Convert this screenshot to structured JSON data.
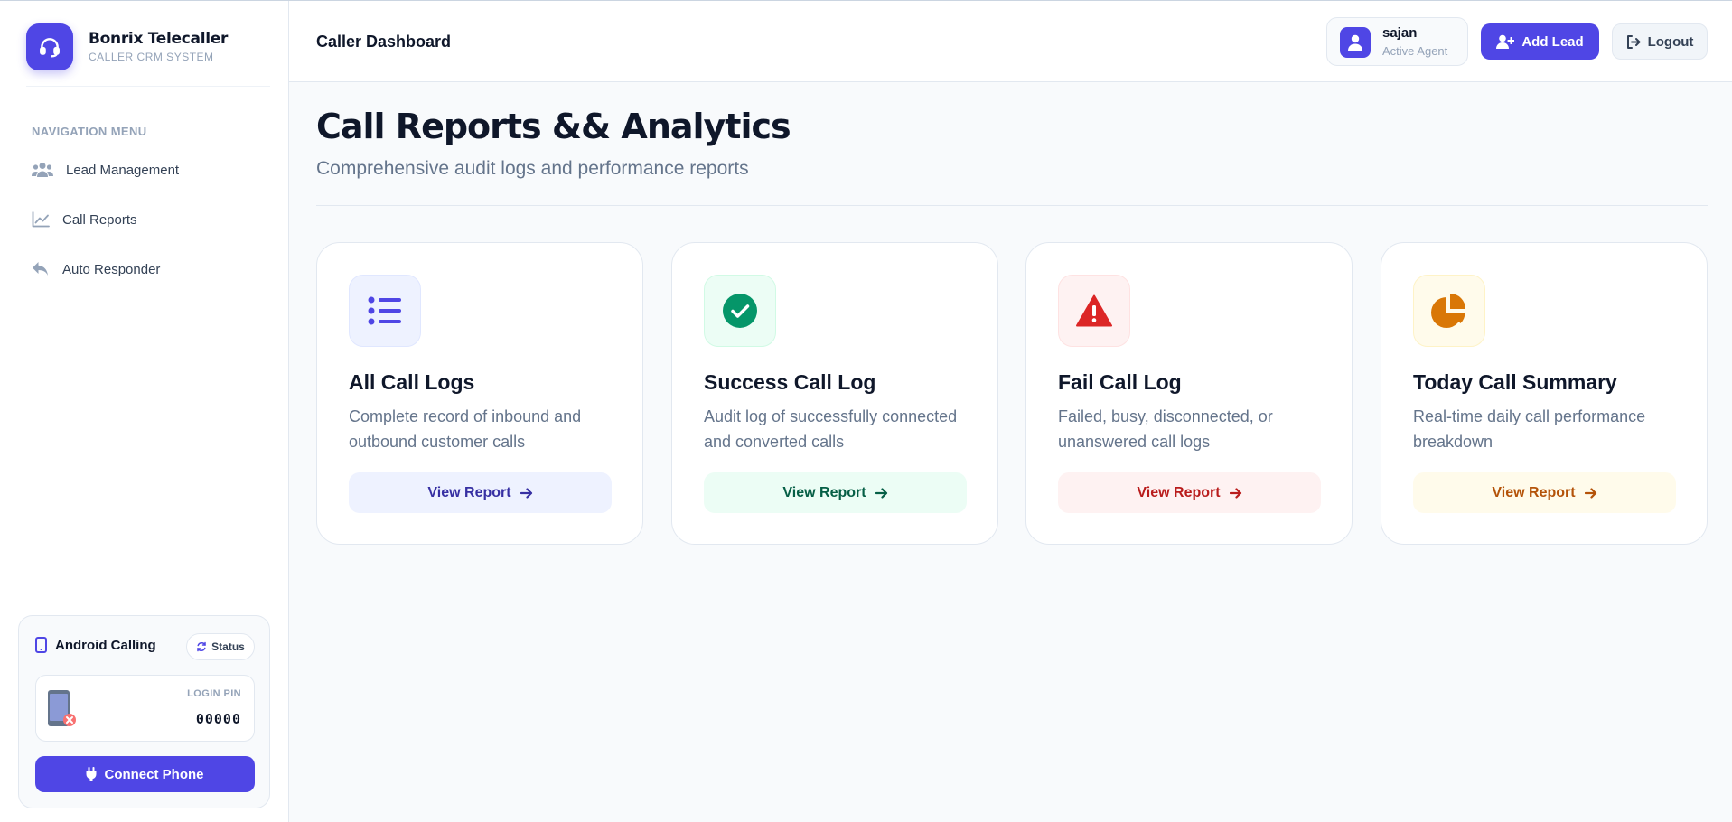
{
  "brand": {
    "name": "Bonrix Telecaller",
    "subtitle": "CALLER CRM SYSTEM",
    "icon": "headset-icon"
  },
  "sidebar": {
    "section_title": "NAVIGATION MENU",
    "items": [
      {
        "label": "Lead Management",
        "icon": "users-icon"
      },
      {
        "label": "Call Reports",
        "icon": "chart-line-icon"
      },
      {
        "label": "Auto Responder",
        "icon": "reply-icon"
      }
    ]
  },
  "android": {
    "title": "Android Calling",
    "status_label": "Status",
    "pin_label": "LOGIN PIN",
    "pin_value": "00000",
    "connect_label": "Connect Phone",
    "connected": false
  },
  "header": {
    "title": "Caller Dashboard",
    "user": {
      "name": "sajan",
      "role": "Active Agent"
    },
    "add_lead_label": "Add Lead",
    "logout_label": "Logout"
  },
  "main": {
    "title": "Call Reports && Analytics",
    "subtitle": "Comprehensive audit logs and performance reports",
    "cards": [
      {
        "title": "All Call Logs",
        "description": "Complete record of inbound and outbound customer calls",
        "button": "View Report",
        "icon": "list-icon",
        "accent": "#4f46e5",
        "tint": "#eef2ff",
        "button_text": "#3730a3"
      },
      {
        "title": "Success Call Log",
        "description": "Audit log of successfully connected and converted calls",
        "button": "View Report",
        "icon": "check-circle-icon",
        "accent": "#059669",
        "tint": "#ecfdf5",
        "button_text": "#065f46"
      },
      {
        "title": "Fail Call Log",
        "description": "Failed, busy, disconnected, or unanswered call logs",
        "button": "View Report",
        "icon": "warning-icon",
        "accent": "#dc2626",
        "tint": "#fef2f2",
        "button_text": "#b91c1c"
      },
      {
        "title": "Today Call Summary",
        "description": "Real-time daily call performance breakdown",
        "button": "View Report",
        "icon": "pie-chart-icon",
        "accent": "#d97706",
        "tint": "#fffbeb",
        "button_text": "#b45309"
      }
    ]
  },
  "colors": {
    "primary": "#4f46e5",
    "text": "#0f172a",
    "muted": "#64748b",
    "border": "#e2e8f0"
  }
}
